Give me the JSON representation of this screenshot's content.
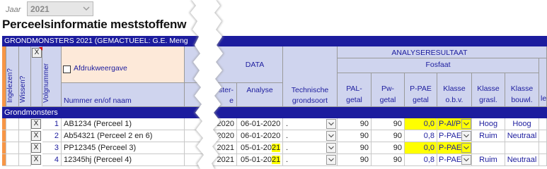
{
  "year": {
    "label": "Jaar",
    "value": "2021"
  },
  "page_title": "Perceelsinformatie meststoffenw",
  "table_title": "GRONDMONSTERS 2021 (GEMACTUEEL: G.E. Meng",
  "header": {
    "ingelezen": "Ingelezen?",
    "wissen": "Wissen?",
    "volgnummer": "Volgnummer",
    "x_label": "X",
    "afdruk": "Afdrukweergave",
    "naam": "Nummer en/of naam",
    "data": "DATA",
    "monster_1": "ster-",
    "monster_2": "e",
    "analyse": "Analyse",
    "techn_1": "Technische",
    "techn_2": "grondsoort",
    "analyseresultaat": "ANALYSERESULTAAT",
    "fosfaat": "Fosfaat",
    "pal_1": "PAL-",
    "pal_2": "getal",
    "pw_1": "Pw-",
    "pw_2": "getal",
    "ppae_1": "P-PAE",
    "ppae_2": "getal",
    "kobv_1": "Klasse",
    "kobv_2": "o.b.v.",
    "kgrasl_1": "Klasse",
    "kgrasl_2": "grasl.",
    "kbouwl_1": "Klasse",
    "kbouwl_2": "bouwl.",
    "last": "le"
  },
  "section_label": "Grondmonsters",
  "rows": [
    {
      "x": "X",
      "nr": "1",
      "naam": "AB1234 (Perceel 1)",
      "monster": "2020",
      "analyse": "06-01-2020",
      "grondsoort": ".",
      "pal": "90",
      "pw": "90",
      "ppae": "0,0",
      "klasse": "P-Al/P",
      "grasl": "Hoog",
      "bouwl": "Hoog",
      "hl_year": false,
      "hl_klasse": true
    },
    {
      "x": "X",
      "nr": "2",
      "naam": "Ab54321 (Perceel 2 en 6)",
      "monster": "2020",
      "analyse": "06-01-2020",
      "grondsoort": ".",
      "pal": "90",
      "pw": "90",
      "ppae": "0,8",
      "klasse": "P-PAE",
      "grasl": "Ruim",
      "bouwl": "Neutraal",
      "hl_year": false,
      "hl_klasse": false
    },
    {
      "x": "X",
      "nr": "3",
      "naam": "PP12345 (Perceel 3)",
      "monster": "2021",
      "analyse_main": "05-01-20",
      "analyse_tail": "21",
      "grondsoort": ".",
      "pal": "90",
      "pw": "90",
      "ppae": "0,0",
      "klasse": "P-PAE",
      "grasl": "",
      "bouwl": "",
      "hl_year": true,
      "hl_klasse": true
    },
    {
      "x": "X",
      "nr": "4",
      "naam": "12345hj (Perceel 4)",
      "monster": "2021",
      "analyse_main": "05-01-20",
      "analyse_tail": "21",
      "grondsoort": ".",
      "pal": "90",
      "pw": "90",
      "ppae": "0,8",
      "klasse": "P-PAE",
      "grasl": "Ruim",
      "bouwl": "Neutraal",
      "hl_year": true,
      "hl_klasse": false
    }
  ],
  "colors": {
    "navy": "#1c1c9e",
    "orange": "#f79646",
    "header_blue": "#cfd4ee",
    "header_peach": "#fde9d9",
    "highlight": "#ffff00"
  }
}
